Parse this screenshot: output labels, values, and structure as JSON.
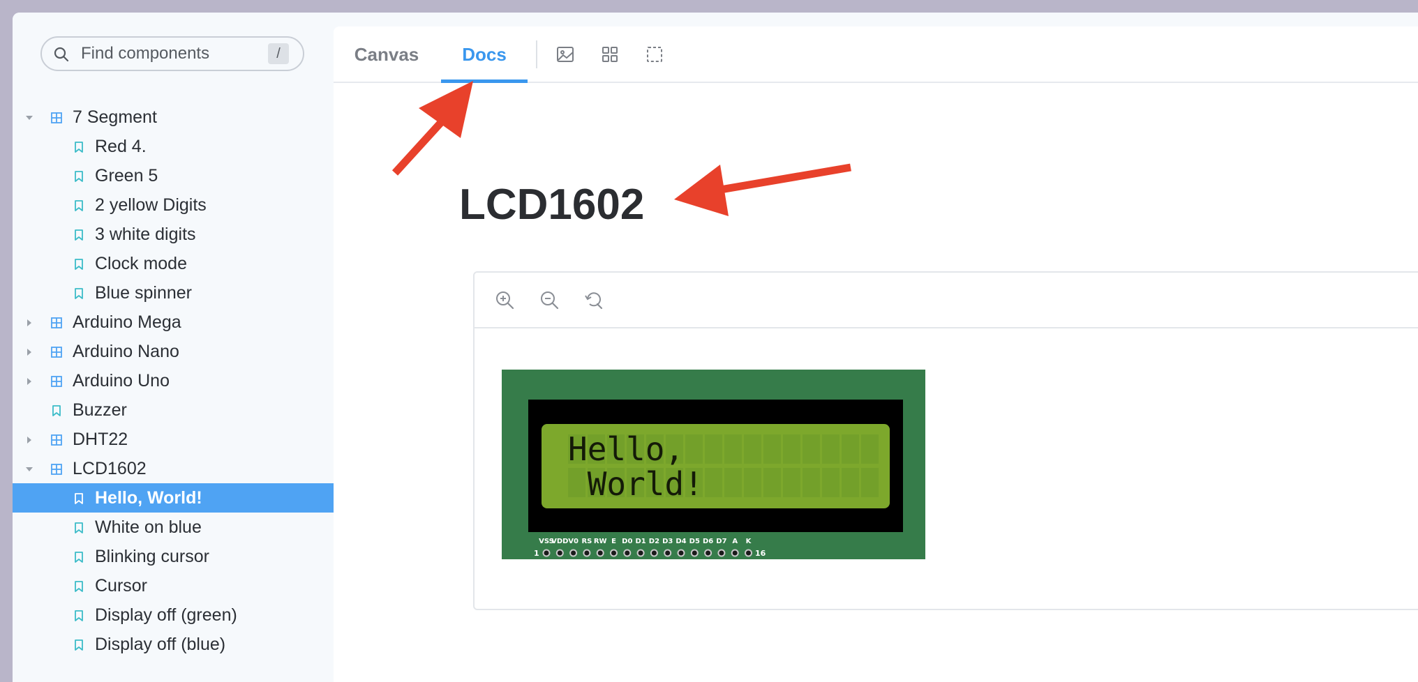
{
  "sidebar": {
    "search": {
      "placeholder": "Find components",
      "shortcut": "/"
    },
    "items": [
      {
        "label": "7 Segment",
        "type": "group",
        "expanded": true,
        "level": 0
      },
      {
        "label": "Red 4.",
        "type": "story",
        "level": 1
      },
      {
        "label": "Green 5",
        "type": "story",
        "level": 1
      },
      {
        "label": "2 yellow Digits",
        "type": "story",
        "level": 1
      },
      {
        "label": "3 white digits",
        "type": "story",
        "level": 1
      },
      {
        "label": "Clock mode",
        "type": "story",
        "level": 1
      },
      {
        "label": "Blue spinner",
        "type": "story",
        "level": 1
      },
      {
        "label": "Arduino Mega",
        "type": "group",
        "expanded": false,
        "level": 0
      },
      {
        "label": "Arduino Nano",
        "type": "group",
        "expanded": false,
        "level": 0
      },
      {
        "label": "Arduino Uno",
        "type": "group",
        "expanded": false,
        "level": 0
      },
      {
        "label": "Buzzer",
        "type": "story",
        "level": 0
      },
      {
        "label": "DHT22",
        "type": "group",
        "expanded": false,
        "level": 0
      },
      {
        "label": "LCD1602",
        "type": "group",
        "expanded": true,
        "level": 0
      },
      {
        "label": "Hello, World!",
        "type": "story",
        "level": 1,
        "selected": true
      },
      {
        "label": "White on blue",
        "type": "story",
        "level": 1
      },
      {
        "label": "Blinking cursor",
        "type": "story",
        "level": 1
      },
      {
        "label": "Cursor",
        "type": "story",
        "level": 1
      },
      {
        "label": "Display off (green)",
        "type": "story",
        "level": 1
      },
      {
        "label": "Display off (blue)",
        "type": "story",
        "level": 1
      }
    ]
  },
  "tabs": [
    {
      "label": "Canvas",
      "active": false
    },
    {
      "label": "Docs",
      "active": true
    }
  ],
  "toolbar_icons": [
    "image-icon",
    "grid-icon",
    "outline-icon"
  ],
  "doc": {
    "title": "LCD1602"
  },
  "preview": {
    "zoom_icons": [
      "zoom-in-icon",
      "zoom-out-icon",
      "reset-zoom-icon"
    ],
    "lcd": {
      "line1": "Hello,",
      "line2": " World!",
      "pin_labels": [
        "VSS",
        "VDD",
        "V0",
        "RS",
        "RW",
        "E",
        "D0",
        "D1",
        "D2",
        "D3",
        "D4",
        "D5",
        "D6",
        "D7",
        "A",
        "K"
      ],
      "pin_first": "1",
      "pin_last": "16"
    }
  },
  "colors": {
    "accent": "#3a97ee",
    "selected_row": "#4fa3f3",
    "pcb_green": "#367c4a",
    "lcd_bg": "#7da82c",
    "annotation_arrow": "#e8412b"
  }
}
